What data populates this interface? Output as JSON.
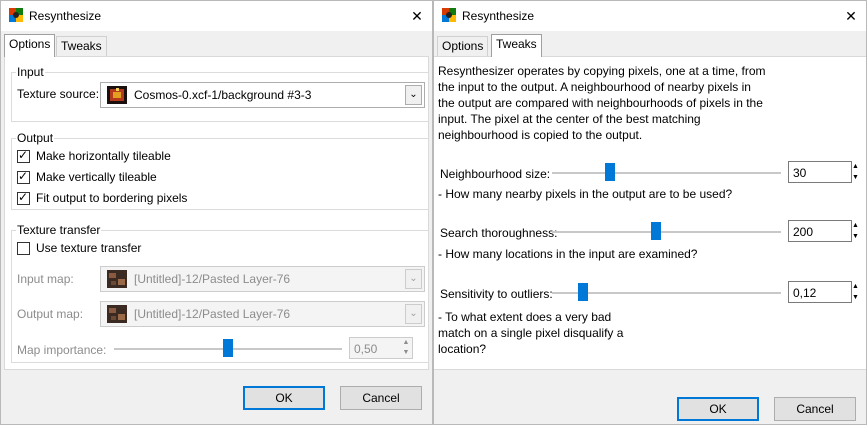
{
  "options_window": {
    "title": "Resynthesize",
    "tabs": [
      {
        "label": "Options",
        "active": true
      },
      {
        "label": "Tweaks",
        "active": false
      }
    ],
    "input_group": {
      "title": "Input",
      "texture_source_label": "Texture source:",
      "texture_source_value": "Cosmos-0.xcf-1/background #3-3"
    },
    "output_group": {
      "title": "Output",
      "checkboxes": [
        {
          "label": "Make horizontally tileable",
          "checked": true
        },
        {
          "label": "Make vertically tileable",
          "checked": true
        },
        {
          "label": "Fit output to bordering pixels",
          "checked": true
        }
      ]
    },
    "transfer_group": {
      "title": "Texture transfer",
      "use_transfer": {
        "label": "Use texture transfer",
        "checked": false
      },
      "input_map_label": "Input map:",
      "input_map_value": "[Untitled]-12/Pasted Layer-76",
      "output_map_label": "Output map:",
      "output_map_value": "[Untitled]-12/Pasted Layer-76",
      "map_importance_label": "Map importance:",
      "map_importance_value": "0,50",
      "map_importance_fraction": 0.5
    },
    "buttons": {
      "ok": "OK",
      "cancel": "Cancel"
    }
  },
  "tweaks_window": {
    "title": "Resynthesize",
    "tabs": [
      {
        "label": "Options",
        "active": false
      },
      {
        "label": "Tweaks",
        "active": true
      }
    ],
    "description": "Resynthesizer operates by copying pixels, one at a time, from the input to the output. A neighbourhood of nearby pixels in the output are compared with neighbourhoods of pixels in the input. The pixel at the center of the best matching neighbourhood is copied to the output.",
    "params": [
      {
        "label": "Neighbourhood size:",
        "value": "30",
        "fraction": 0.24,
        "hint": "- How many nearby pixels in the output are to be used?"
      },
      {
        "label": "Search thoroughness:",
        "value": "200",
        "fraction": 0.45,
        "hint": "- How many locations in the input are examined?"
      },
      {
        "label": "Sensitivity to outliers:",
        "value": "0,12",
        "fraction": 0.12,
        "hint": "- To what extent does a very bad match on a single pixel disqualify a location?"
      }
    ],
    "buttons": {
      "ok": "OK",
      "cancel": "Cancel"
    }
  },
  "icons": {
    "app": "resynthesize-app-icon",
    "close": "close-icon",
    "dropdown": "chevron-down-icon",
    "check": "check-mark-icon"
  },
  "colors": {
    "accent": "#0078d7",
    "window_bg": "#f0f0f0",
    "panel_bg": "#ffffff"
  }
}
